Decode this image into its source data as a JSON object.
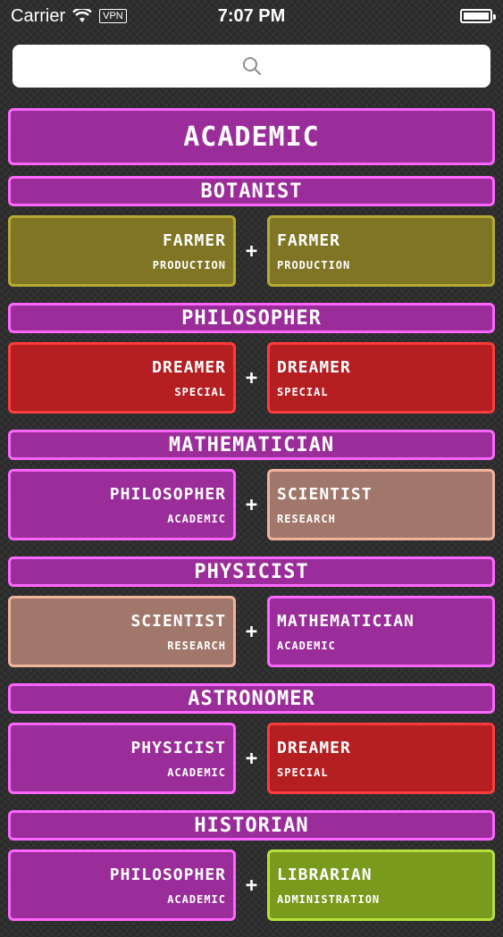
{
  "status": {
    "carrier": "Carrier",
    "vpn": "VPN",
    "time": "7:07 PM"
  },
  "search": {
    "placeholder": ""
  },
  "category": {
    "title": "ACADEMIC"
  },
  "colors": {
    "academic": {
      "bg": "#9a2d9a",
      "border": "#ff66ff"
    },
    "production": {
      "bg": "#807524",
      "border": "#b5aa33"
    },
    "special": {
      "bg": "#b51f22",
      "border": "#ff3b3b"
    },
    "research": {
      "bg": "#a2776b",
      "border": "#f1b39e"
    },
    "administration": {
      "bg": "#7a9a1e",
      "border": "#b4e13a"
    }
  },
  "recipes": [
    {
      "title": "BOTANIST",
      "left": {
        "name": "FARMER",
        "type": "PRODUCTION",
        "style": "production"
      },
      "right": {
        "name": "FARMER",
        "type": "PRODUCTION",
        "style": "production"
      }
    },
    {
      "title": "PHILOSOPHER",
      "left": {
        "name": "DREAMER",
        "type": "SPECIAL",
        "style": "special"
      },
      "right": {
        "name": "DREAMER",
        "type": "SPECIAL",
        "style": "special"
      }
    },
    {
      "title": "MATHEMATICIAN",
      "left": {
        "name": "PHILOSOPHER",
        "type": "ACADEMIC",
        "style": "academic"
      },
      "right": {
        "name": "SCIENTIST",
        "type": "RESEARCH",
        "style": "research"
      }
    },
    {
      "title": "PHYSICIST",
      "left": {
        "name": "SCIENTIST",
        "type": "RESEARCH",
        "style": "research"
      },
      "right": {
        "name": "MATHEMATICIAN",
        "type": "ACADEMIC",
        "style": "academic"
      }
    },
    {
      "title": "ASTRONOMER",
      "left": {
        "name": "PHYSICIST",
        "type": "ACADEMIC",
        "style": "academic"
      },
      "right": {
        "name": "DREAMER",
        "type": "SPECIAL",
        "style": "special"
      }
    },
    {
      "title": "HISTORIAN",
      "left": {
        "name": "PHILOSOPHER",
        "type": "ACADEMIC",
        "style": "academic"
      },
      "right": {
        "name": "LIBRARIAN",
        "type": "ADMINISTRATION",
        "style": "administration"
      }
    }
  ],
  "plus": "+"
}
